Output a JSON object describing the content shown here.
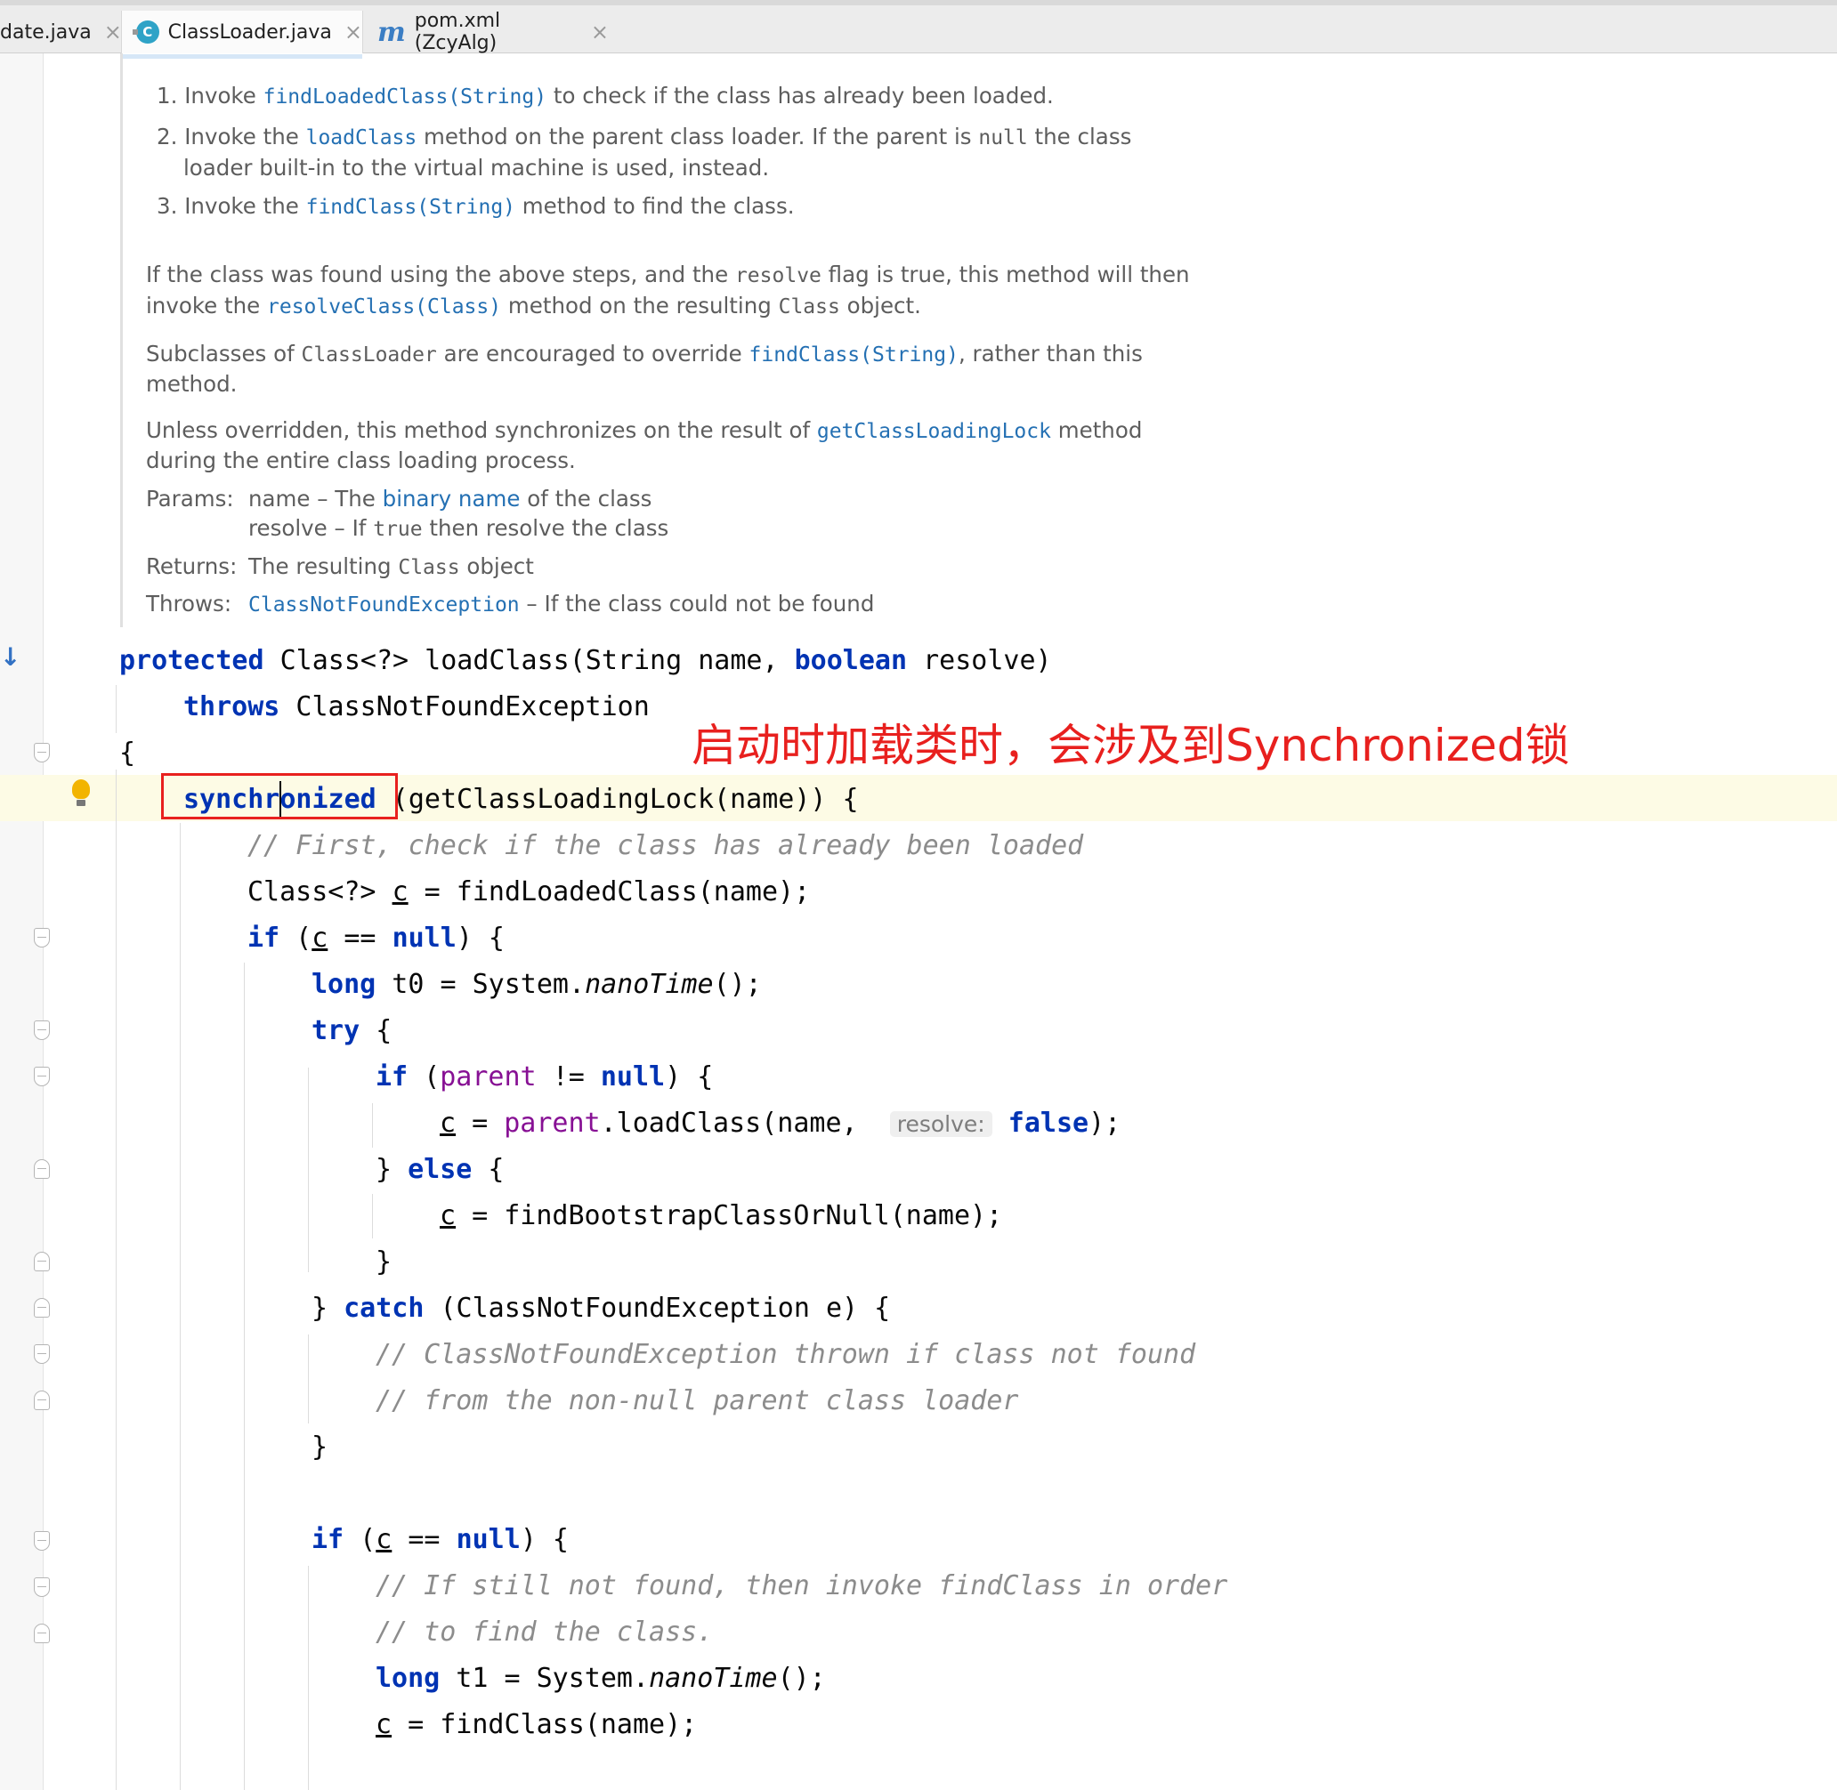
{
  "tabs": [
    {
      "label": "date.java",
      "active": false
    },
    {
      "label": "ClassLoader.java",
      "active": true,
      "icon": "class-icon"
    },
    {
      "label": "pom.xml (ZcyAlg)",
      "active": false,
      "icon": "maven-icon"
    }
  ],
  "tab_close_glyph": "×",
  "doc": {
    "list": [
      {
        "num": "1.",
        "pre": "Invoke ",
        "code": "findLoadedClass(String)",
        "post": " to check if the class has already been loaded."
      },
      {
        "num": "2.",
        "pre": "Invoke the ",
        "code": "loadClass",
        "post1": " method on the parent class loader. If the parent is ",
        "code2": "null",
        "post2": " the class",
        "line2": "loader built-in to the virtual machine is used, instead."
      },
      {
        "num": "3.",
        "pre": "Invoke the ",
        "code": "findClass(String)",
        "post": " method to find the class."
      }
    ],
    "para1": {
      "pre": "If the class was found using the above steps, and the ",
      "code": "resolve",
      "post": " flag is true, this method will then",
      "line2_pre": "invoke the ",
      "line2_link": "resolveClass(Class)",
      "line2_mid": " method on the resulting ",
      "line2_code": "Class",
      "line2_post": " object."
    },
    "para2": {
      "pre": "Subclasses of ",
      "code": "ClassLoader",
      "mid": " are encouraged to override ",
      "link": "findClass(String)",
      "post": ", rather than this",
      "line2": "method."
    },
    "para3": {
      "pre": "Unless overridden, this method synchronizes on the result of ",
      "link": "getClassLoadingLock",
      "post": " method",
      "line2": "during the entire class loading process."
    },
    "params_label": "Params:",
    "param1_pre": "name – The ",
    "param1_link": "binary name",
    "param1_post": " of the class",
    "param2_pre": "resolve – If ",
    "param2_code": "true",
    "param2_post": " then resolve the class",
    "returns_label": "Returns:",
    "returns_pre": "The resulting ",
    "returns_code": "Class",
    "returns_post": " object",
    "throws_label": "Throws:",
    "throws_link": "ClassNotFoundException",
    "throws_post": " – If the class could not be found"
  },
  "code": {
    "l1_kw": "protected",
    "l1_a": " Class<?> loadClass(String name, ",
    "l1_kw2": "boolean",
    "l1_b": " resolve)",
    "l2_kw": "throws",
    "l2_a": " ClassNotFoundException",
    "l3": "{",
    "l4_kw": "synchronized",
    "l4_a": " (getClassLoadingLock(name)) {",
    "l5": "// First, check if the class has already been loaded",
    "l6_a": "Class<?> ",
    "l6_c": "c",
    "l6_b": " = findLoadedClass(name);",
    "l7_kw": "if",
    "l7_a": " (",
    "l7_c": "c",
    "l7_b": " == ",
    "l7_kw2": "null",
    "l7_d": ") {",
    "l8_kw": "long",
    "l8_a": " t0 = System.",
    "l8_it": "nanoTime",
    "l8_b": "();",
    "l9_kw": "try",
    "l9_a": " {",
    "l10_kw": "if",
    "l10_a": " (",
    "l10_f": "parent",
    "l10_b": " != ",
    "l10_kw2": "null",
    "l10_c": ") {",
    "l11_c": "c",
    "l11_a": " = ",
    "l11_f": "parent",
    "l11_b": ".loadClass(name, ",
    "l11_hint": "resolve:",
    "l11_kw": "false",
    "l11_d": ");",
    "l12_a": "} ",
    "l12_kw": "else",
    "l12_b": " {",
    "l13_c": "c",
    "l13_a": " = findBootstrapClassOrNull(name);",
    "l14": "}",
    "l15_a": "} ",
    "l15_kw": "catch",
    "l15_b": " (ClassNotFoundException e) {",
    "l16": "// ClassNotFoundException thrown if class not found",
    "l17": "// from the non-null parent class loader",
    "l18": "}",
    "l19_kw": "if",
    "l19_a": " (",
    "l19_c": "c",
    "l19_b": " == ",
    "l19_kw2": "null",
    "l19_d": ") {",
    "l20": "// If still not found, then invoke findClass in order",
    "l21": "// to find the class.",
    "l22_kw": "long",
    "l22_a": " t1 = System.",
    "l22_it": "nanoTime",
    "l22_b": "();",
    "l23_c": "c",
    "l23_a": " = findClass(name);"
  },
  "annotation": "启动时加载类时，会涉及到Synchronized锁",
  "colors": {
    "keyword": "#0033b3",
    "field": "#871094",
    "comment": "#8c8c8c",
    "link": "#2470b3",
    "annotation": "#e8201e",
    "highlight_line": "#fdfbe5"
  }
}
